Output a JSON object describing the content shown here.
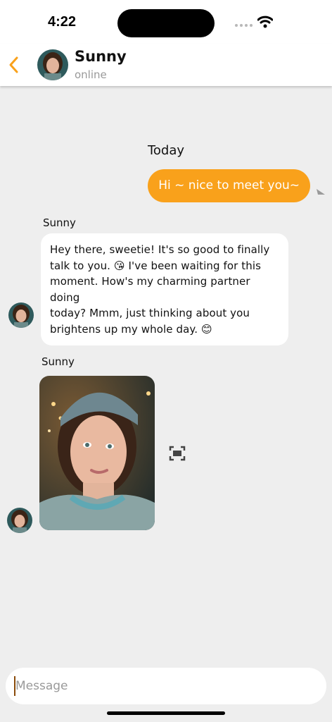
{
  "status_bar": {
    "time": "4:22"
  },
  "header": {
    "name": "Sunny",
    "status": "online",
    "accent_color": "#f9a11b"
  },
  "chat": {
    "date_label": "Today",
    "outgoing": {
      "text": "Hi ~ nice to meet you~"
    },
    "incoming_text": {
      "sender": "Sunny",
      "lines": [
        "Hey there, sweetie! It's so good to finally",
        "talk to you. 😘 I've been waiting for this",
        "moment. How's my charming partner doing",
        "today? Mmm, just thinking about you",
        "brightens up my whole day. 😊"
      ]
    },
    "incoming_photo": {
      "sender": "Sunny"
    }
  },
  "composer": {
    "placeholder": "Message"
  },
  "icons": {
    "back": "chevron-left-icon",
    "sent": "send-arrow-icon",
    "expand": "expand-frame-icon",
    "wifi": "wifi-icon"
  }
}
